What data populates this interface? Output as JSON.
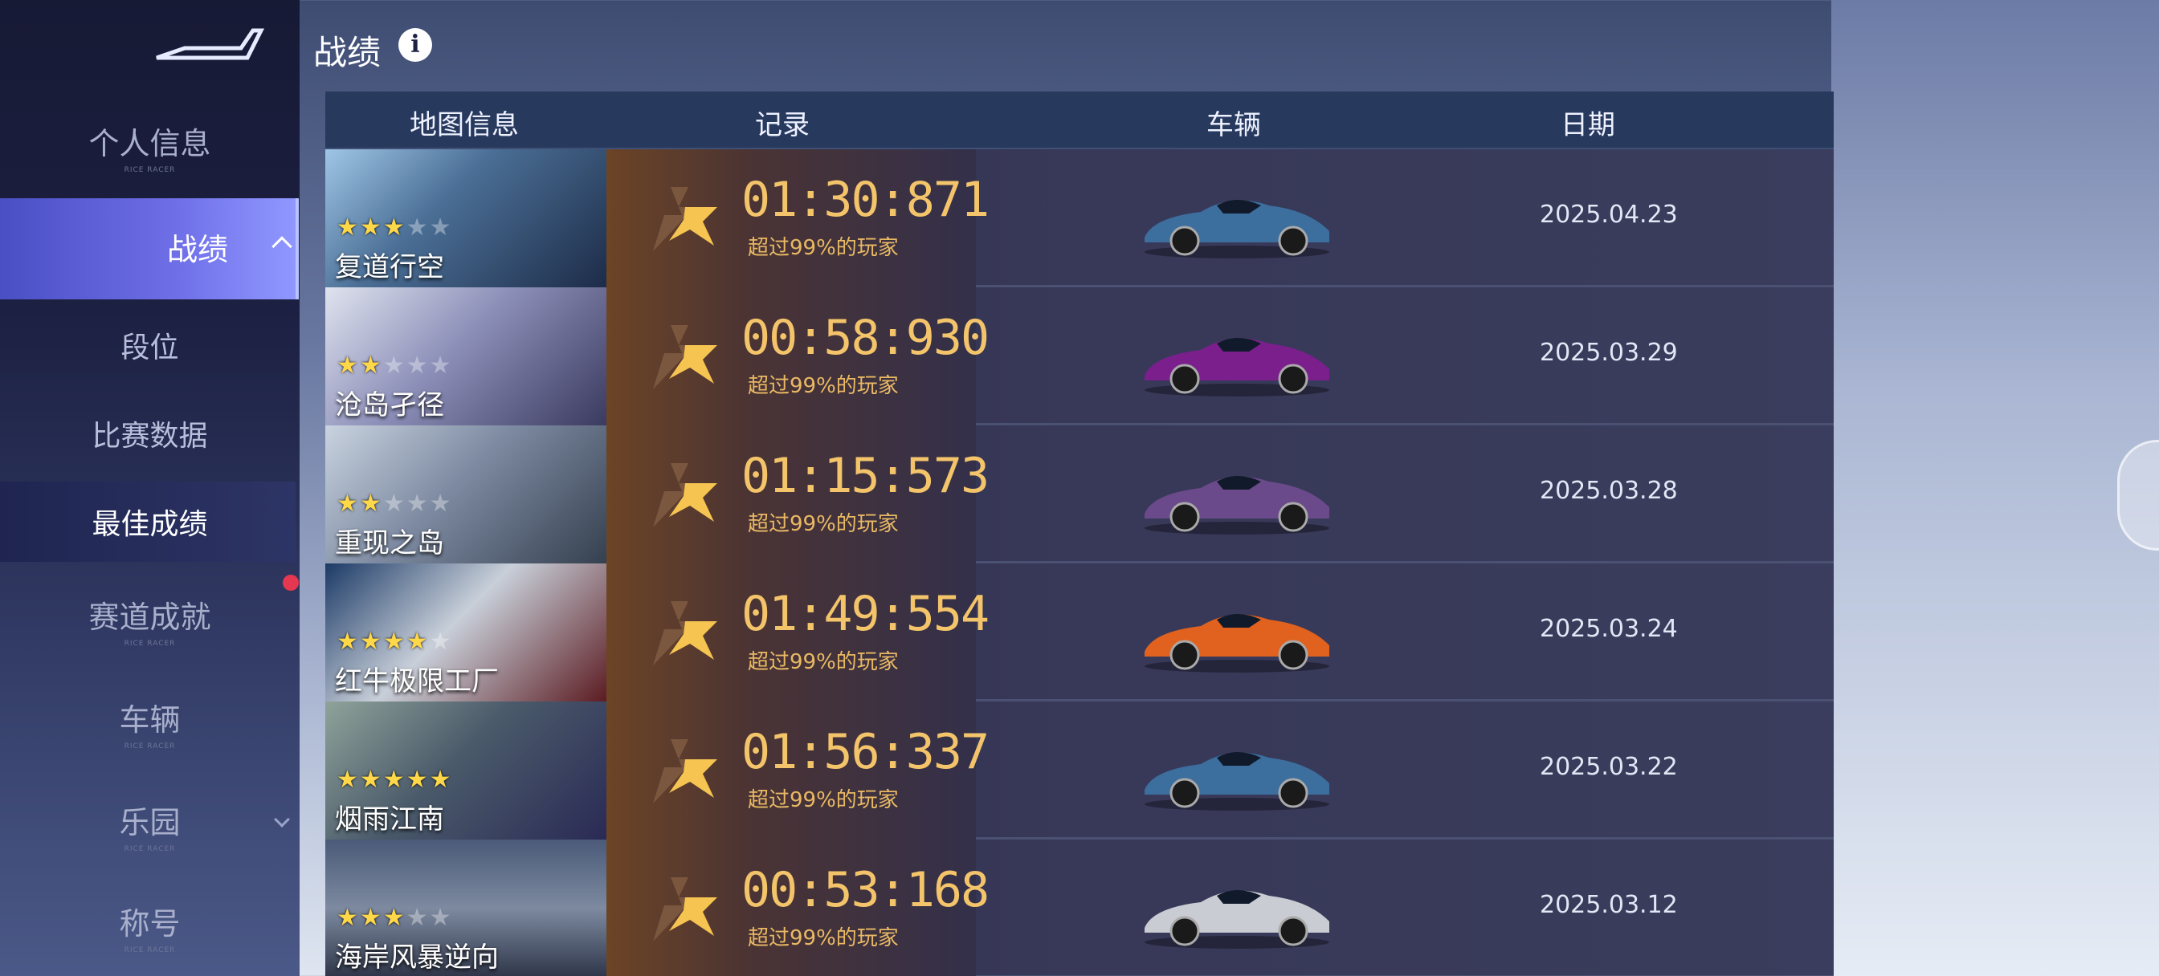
{
  "sidebar": {
    "items": [
      {
        "label": "个人信息",
        "sub": "RICE RACER"
      },
      {
        "label": "战绩"
      },
      {
        "label": "赛道成就",
        "sub": "RICE RACER"
      },
      {
        "label": "车辆",
        "sub": "RICE RACER"
      },
      {
        "label": "乐园",
        "sub": "RICE RACER"
      },
      {
        "label": "称号",
        "sub": "RICE RACER"
      }
    ],
    "sub_items": [
      "段位",
      "比赛数据",
      "最佳成绩"
    ],
    "selected_sub": "最佳成绩",
    "notification_dot_color": "#e5374f"
  },
  "header": {
    "title": "战绩",
    "info_icon": "info-icon"
  },
  "table": {
    "columns": [
      "地图信息",
      "记录",
      "车辆",
      "日期"
    ],
    "rows": [
      {
        "map": "复道行空",
        "stars": 3,
        "time": "01:30:871",
        "percentile": "超过99%的玩家",
        "car_color": "#3c6e9e",
        "date": "2025.04.23"
      },
      {
        "map": "沧岛孑径",
        "stars": 2,
        "time": "00:58:930",
        "percentile": "超过99%的玩家",
        "car_color": "#7a1f8c",
        "date": "2025.03.29"
      },
      {
        "map": "重现之岛",
        "stars": 2,
        "time": "01:15:573",
        "percentile": "超过99%的玩家",
        "car_color": "#6a4a8a",
        "date": "2025.03.28"
      },
      {
        "map": "红牛极限工厂",
        "stars": 4,
        "time": "01:49:554",
        "percentile": "超过99%的玩家",
        "car_color": "#e0621e",
        "date": "2025.03.24"
      },
      {
        "map": "烟雨江南",
        "stars": 5,
        "time": "01:56:337",
        "percentile": "超过99%的玩家",
        "car_color": "#3c6e9e",
        "date": "2025.03.22"
      },
      {
        "map": "海岸风暴逆向",
        "stars": 3,
        "time": "00:53:168",
        "percentile": "超过99%的玩家",
        "car_color": "#c9ccd2",
        "date": "2025.03.12"
      }
    ]
  },
  "colors": {
    "accent": "#6f6fe8",
    "record_gold": "#f3c46a"
  }
}
